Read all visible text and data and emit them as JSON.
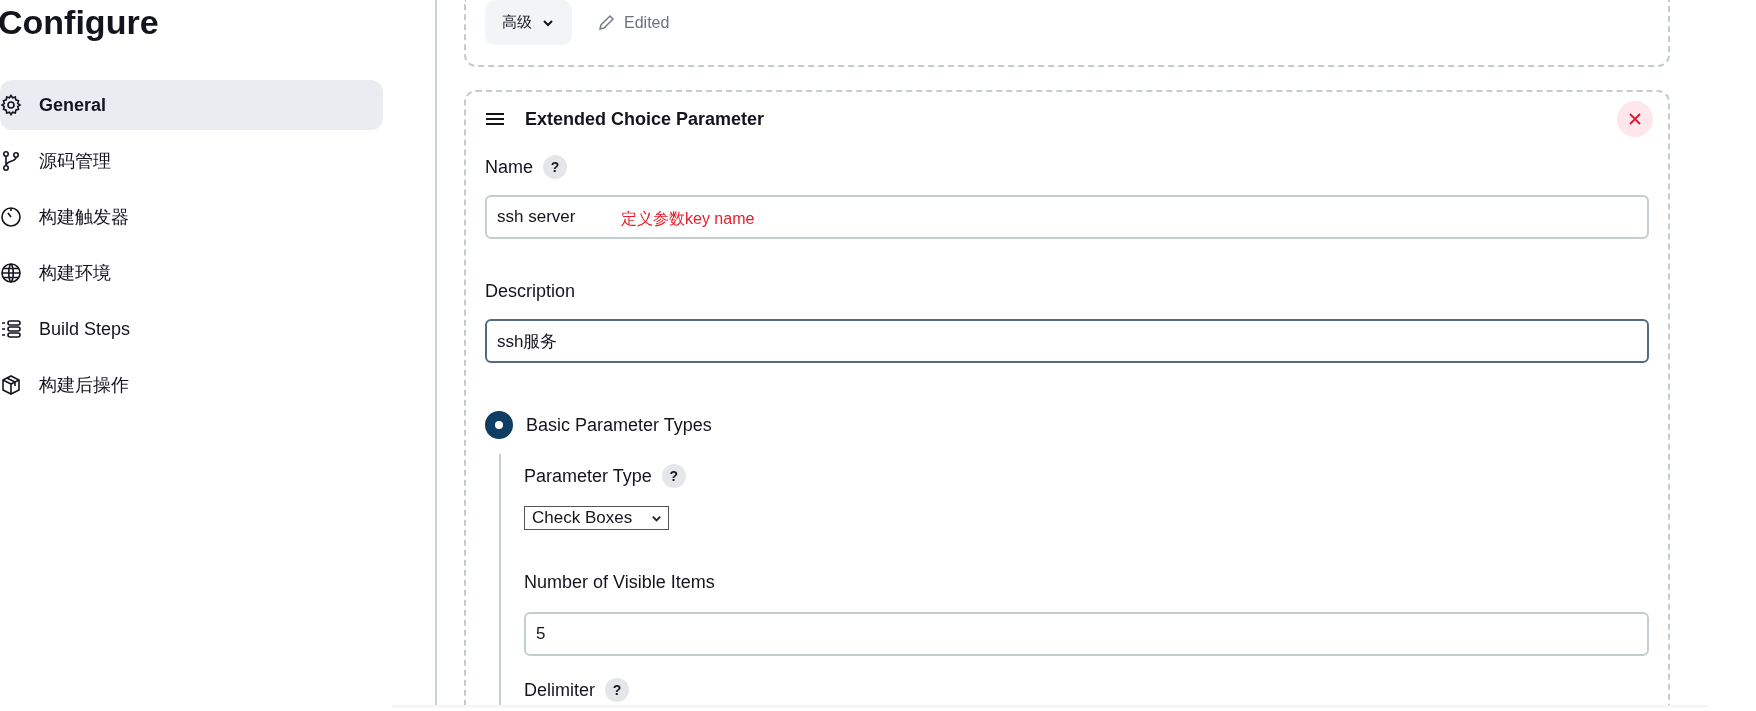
{
  "page_title": "Configure",
  "sidebar": {
    "items": [
      {
        "label": "General",
        "kind": "gear",
        "selected": true
      },
      {
        "label": "源码管理",
        "kind": "branch",
        "selected": false
      },
      {
        "label": "构建触发器",
        "kind": "timer",
        "selected": false
      },
      {
        "label": "构建环境",
        "kind": "globe",
        "selected": false
      },
      {
        "label": "Build Steps",
        "kind": "steps",
        "selected": false
      },
      {
        "label": "构建后操作",
        "kind": "package",
        "selected": false
      }
    ]
  },
  "top_card": {
    "advanced_button": "高级",
    "status": "Edited"
  },
  "parameter": {
    "title": "Extended Choice Parameter",
    "name_field": {
      "label": "Name",
      "help": "?",
      "value": "ssh server",
      "annotation": "定义参数key name"
    },
    "description_field": {
      "label": "Description",
      "value": "ssh服务",
      "focused": true
    },
    "parameter_source": {
      "label": "Basic Parameter Types",
      "selected": true
    },
    "parameter_type": {
      "label": "Parameter Type",
      "help": "?",
      "value": "Check Boxes"
    },
    "visible_items": {
      "label": "Number of Visible Items",
      "value": "5"
    },
    "delimiter": {
      "label": "Delimiter",
      "help": "?"
    }
  }
}
